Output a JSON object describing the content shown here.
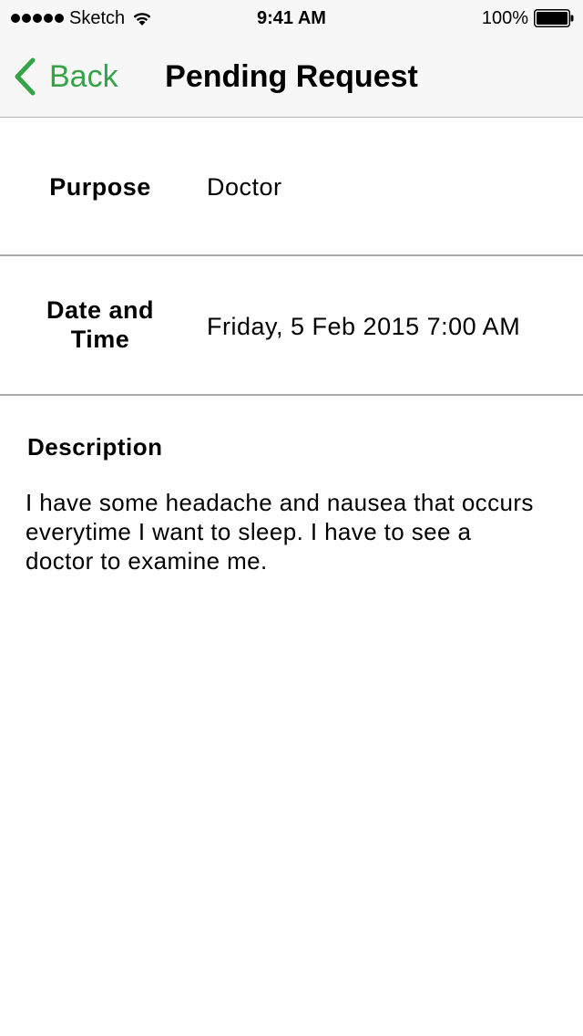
{
  "status_bar": {
    "carrier": "Sketch",
    "time": "9:41 AM",
    "battery": "100%",
    "icons": [
      "signal-dots-icon",
      "wifi-icon",
      "battery-icon"
    ]
  },
  "nav": {
    "back_label": "Back",
    "title": "Pending Request",
    "accent_color": "#35a346"
  },
  "details": {
    "purpose_label": "Purpose",
    "purpose_value": "Doctor",
    "datetime_label": "Date and Time",
    "datetime_value": "Friday, 5 Feb 2015 7:00 AM"
  },
  "description": {
    "heading": "Description",
    "body": "I have some headache and nausea that occurs everytime I want to sleep. I have to see a doctor to examine me."
  }
}
